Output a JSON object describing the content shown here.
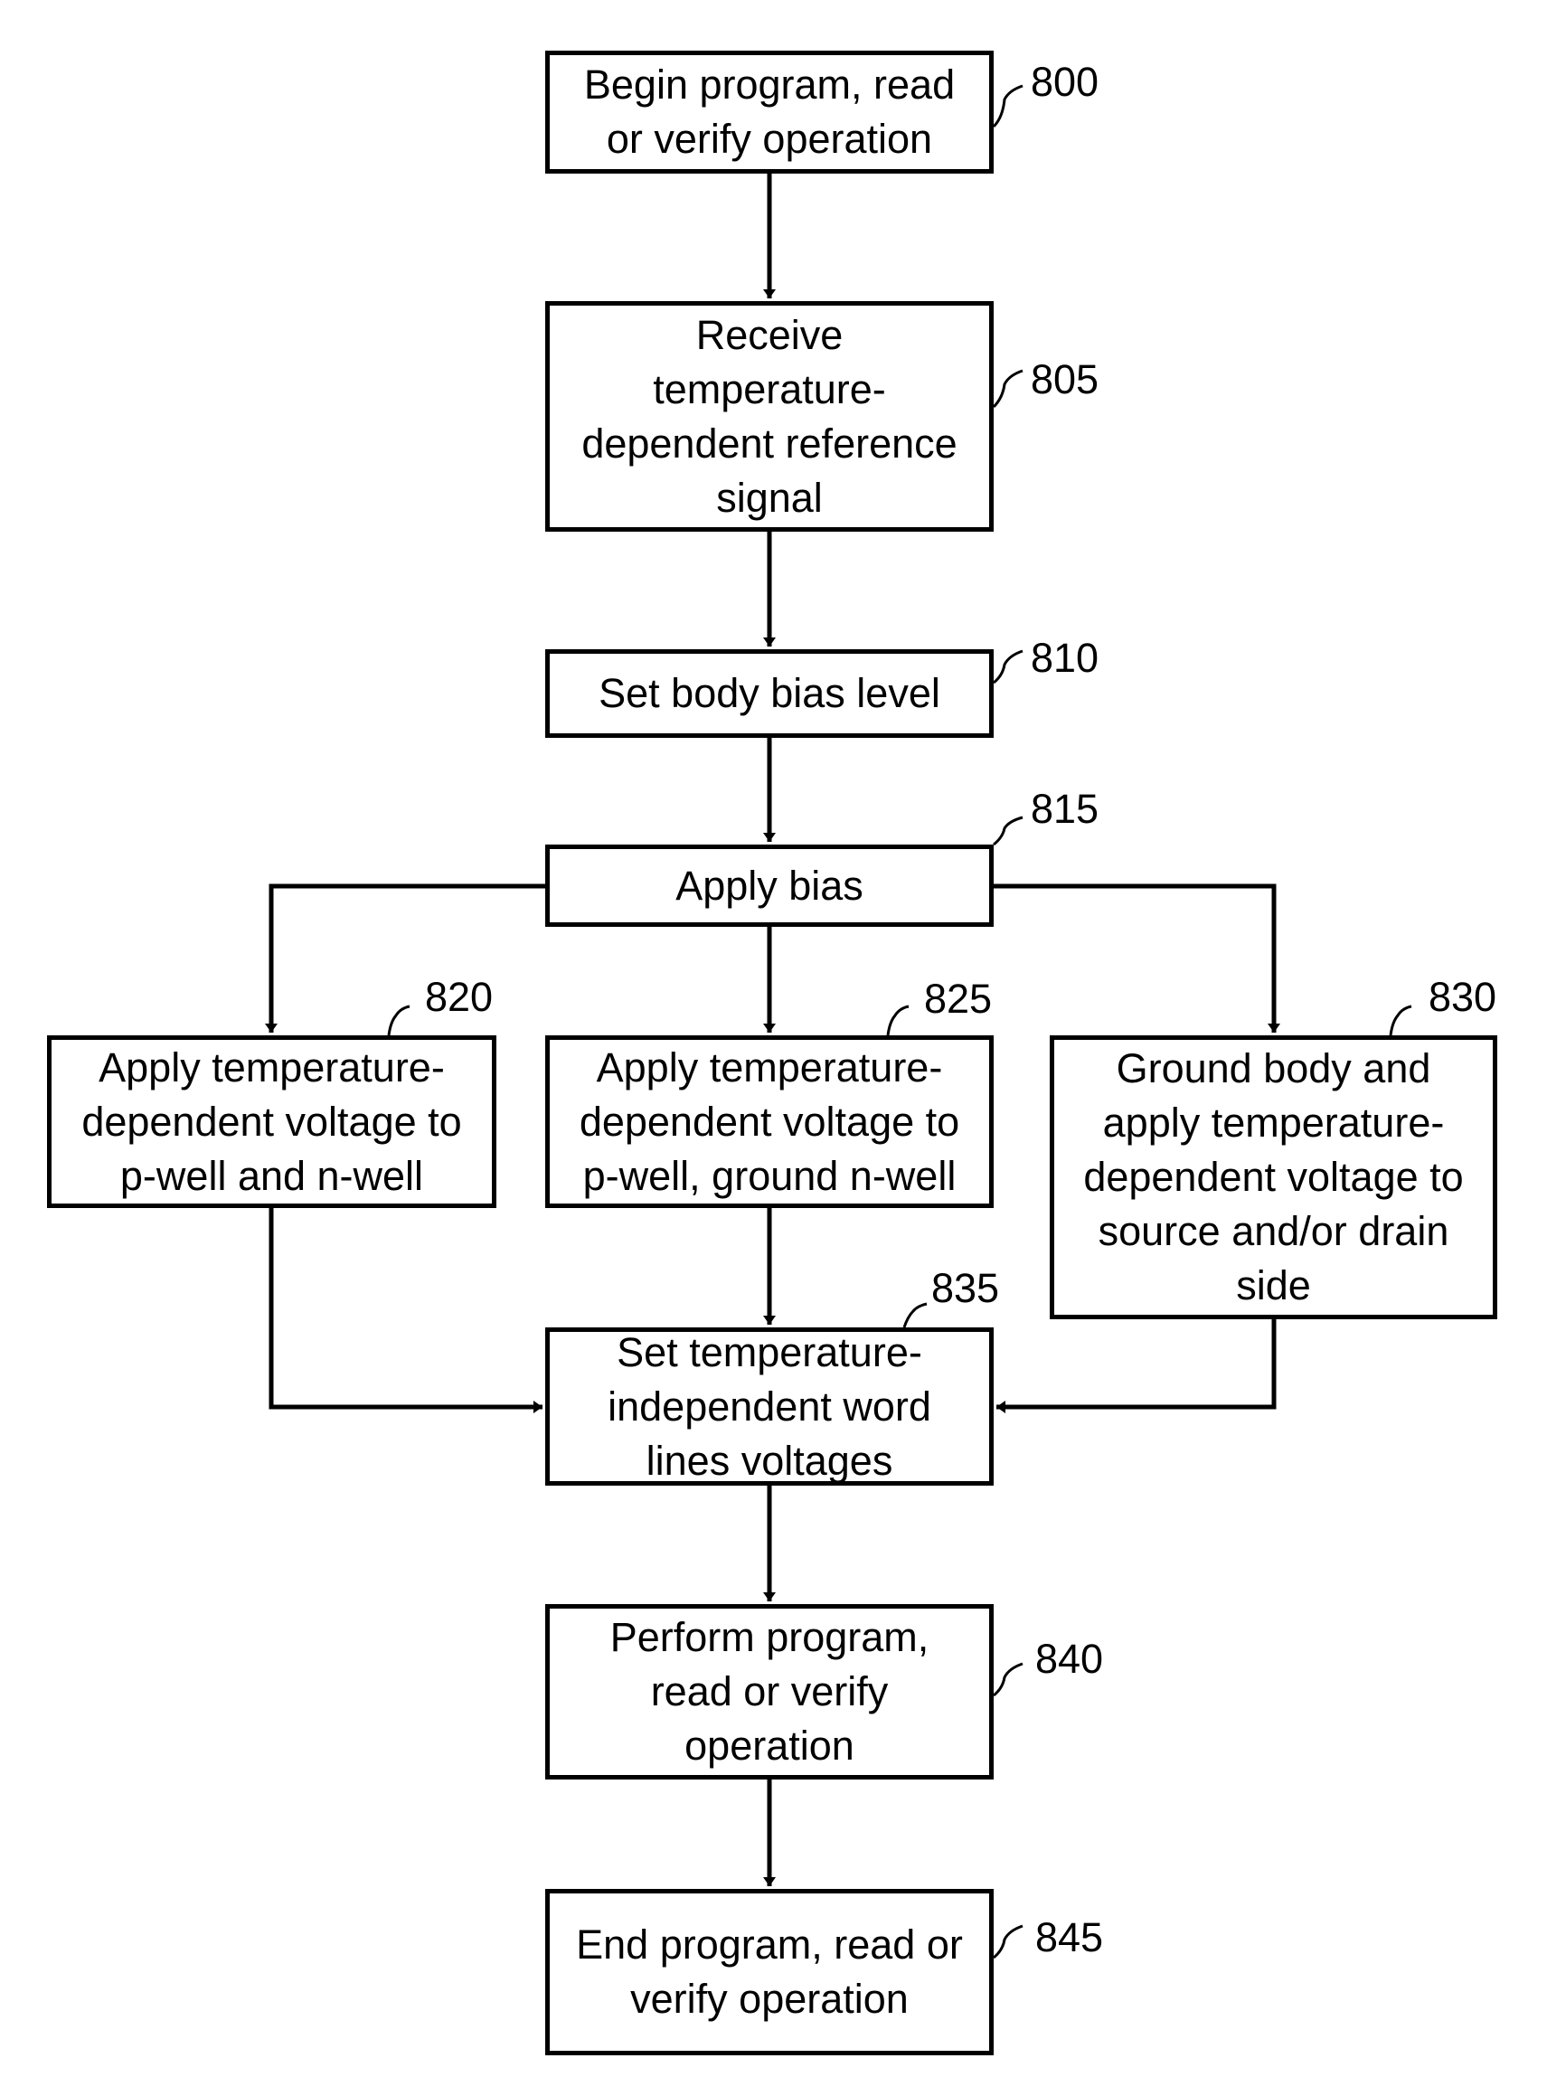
{
  "diagram": {
    "steps": [
      {
        "id": "800",
        "text": "Begin program, read\nor verify operation"
      },
      {
        "id": "805",
        "text": "Receive\ntemperature-\ndependent reference\nsignal"
      },
      {
        "id": "810",
        "text": "Set body bias level"
      },
      {
        "id": "815",
        "text": "Apply bias"
      },
      {
        "id": "820",
        "text": "Apply temperature-\ndependent voltage to\np-well and n-well"
      },
      {
        "id": "825",
        "text": "Apply temperature-\ndependent voltage to\np-well, ground n-well"
      },
      {
        "id": "830",
        "text": "Ground body and\napply temperature-\ndependent voltage to\nsource and/or drain\nside"
      },
      {
        "id": "835",
        "text": "Set temperature-\nindependent word\nlines voltages"
      },
      {
        "id": "840",
        "text": "Perform program,\nread or verify\noperation"
      },
      {
        "id": "845",
        "text": "End program, read or\nverify operation"
      }
    ],
    "edges": [
      [
        "800",
        "805"
      ],
      [
        "805",
        "810"
      ],
      [
        "810",
        "815"
      ],
      [
        "815",
        "820"
      ],
      [
        "815",
        "825"
      ],
      [
        "815",
        "830"
      ],
      [
        "820",
        "835"
      ],
      [
        "825",
        "835"
      ],
      [
        "830",
        "835"
      ],
      [
        "835",
        "840"
      ],
      [
        "840",
        "845"
      ]
    ]
  }
}
